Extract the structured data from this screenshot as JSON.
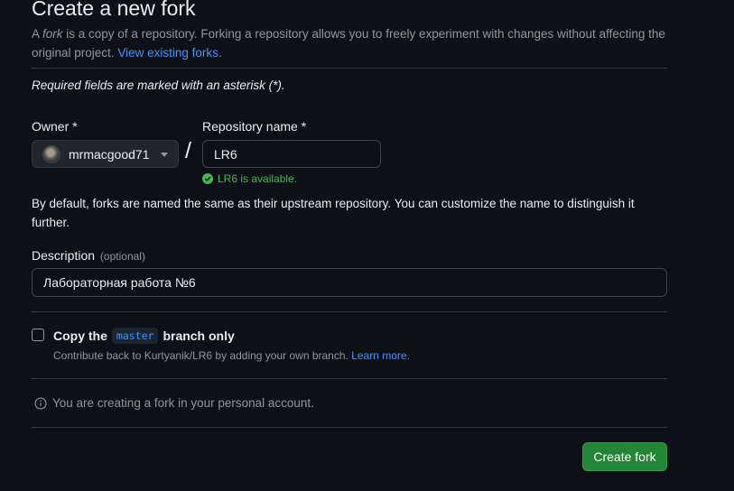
{
  "header": {
    "title": "Create a new fork",
    "intro_prefix": "A ",
    "intro_em": "fork",
    "intro_line": " is a copy of a repository. Forking a repository allows you to freely experiment with changes without affecting the original project. ",
    "view_forks_link": "View existing forks."
  },
  "form": {
    "required_note": "Required fields are marked with an asterisk (*).",
    "owner": {
      "label": "Owner *",
      "value": "mrmacgood71"
    },
    "separator": "/",
    "repo_name": {
      "label": "Repository name *",
      "value": "LR6",
      "availability": "LR6 is available."
    },
    "default_note": "By default, forks are named the same as their upstream repository. You can customize the name to distinguish it further.",
    "description": {
      "label": "Description",
      "optional": "(optional)",
      "value": "Лабораторная работа №6"
    },
    "copy_branch": {
      "checked": false,
      "label_prefix": "Copy the",
      "branch": "master",
      "label_suffix": "branch only",
      "desc": "Contribute back to Kurtyanik/LR6 by adding your own branch.",
      "learn_more": "Learn more."
    },
    "info": "You are creating a fork in your personal account.",
    "submit_label": "Create fork"
  },
  "colors": {
    "background": "#0d1117",
    "link": "#4493f8",
    "success": "#3fb950",
    "primary_button": "#238636",
    "muted_text": "#8d96a0"
  }
}
